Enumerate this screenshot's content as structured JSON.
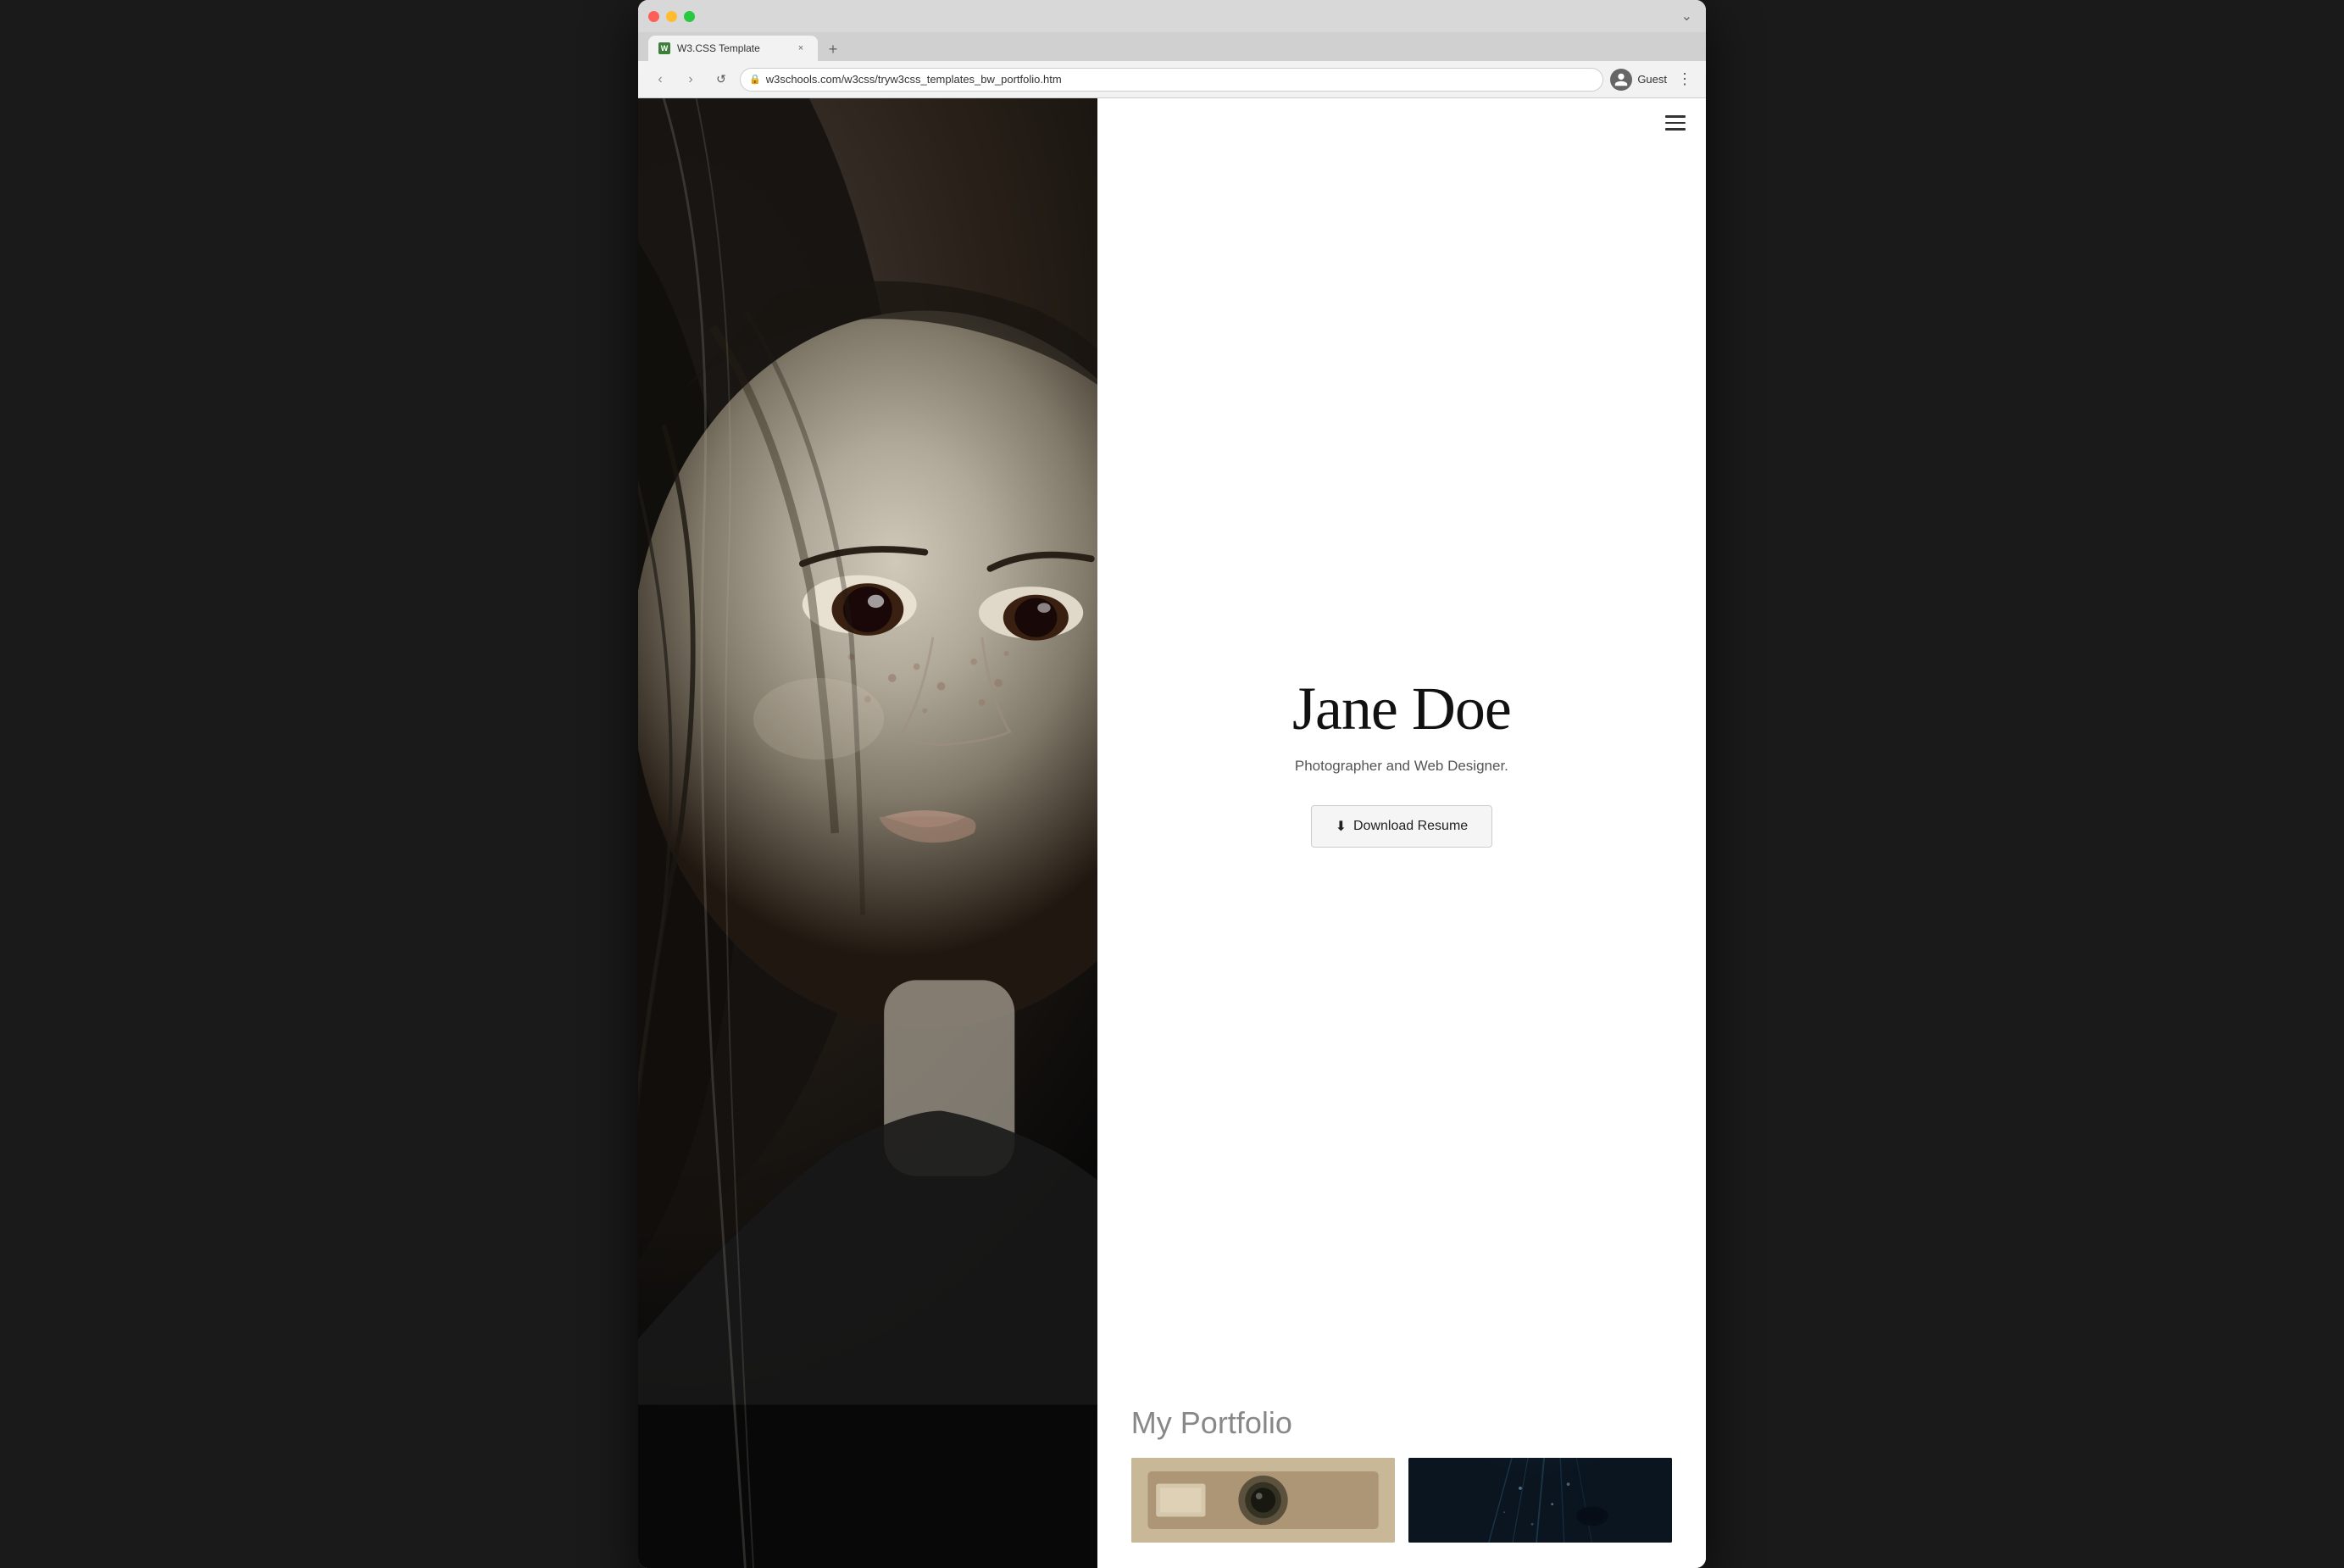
{
  "browser": {
    "tab_favicon": "W",
    "tab_title": "W3.CSS Template",
    "tab_close": "×",
    "tab_new": "+",
    "tab_dropdown": "⌄",
    "address_url": "w3schools.com/w3css/tryw3css_templates_bw_portfolio.htm",
    "profile_name": "Guest",
    "menu_icon": "⋮"
  },
  "nav": {
    "hamburger_lines": 3
  },
  "hero": {
    "name": "Jane Doe",
    "subtitle": "Photographer and Web Designer.",
    "download_button": "Download Resume"
  },
  "portfolio": {
    "section_title": "My Portfolio"
  },
  "icons": {
    "back": "‹",
    "forward": "›",
    "refresh": "↺",
    "lock": "🔒",
    "download": "⬇"
  }
}
